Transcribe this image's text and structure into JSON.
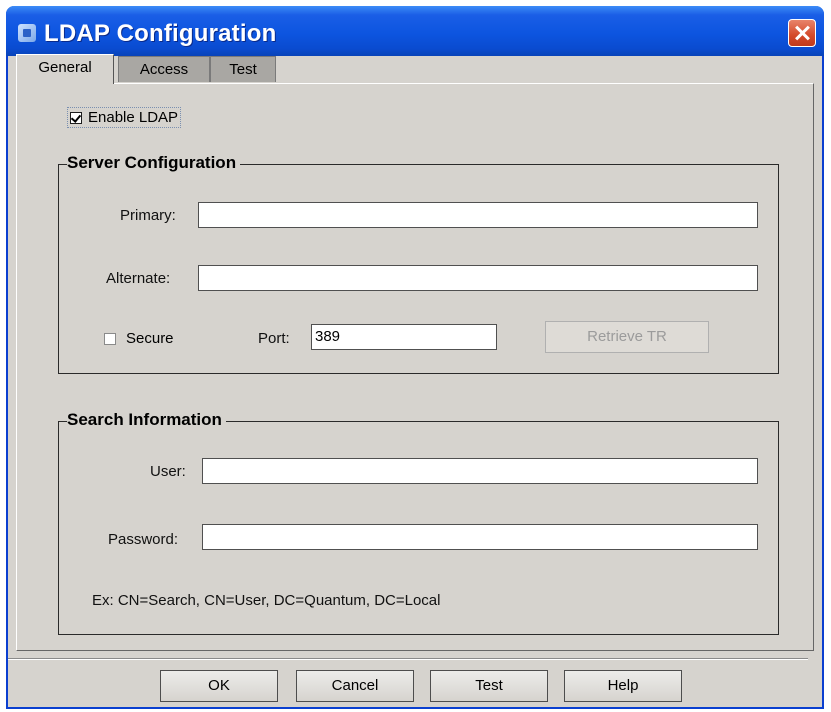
{
  "window": {
    "title": "LDAP Configuration"
  },
  "tabs": [
    {
      "label": "General",
      "active": true
    },
    {
      "label": "Access",
      "active": false
    },
    {
      "label": "Test",
      "active": false
    }
  ],
  "enable_ldap": {
    "label": "Enable LDAP",
    "checked": true
  },
  "server": {
    "title": "Server Configuration",
    "primary_label": "Primary:",
    "primary_value": "",
    "alternate_label": "Alternate:",
    "alternate_value": "",
    "secure_label": "Secure",
    "secure_checked": false,
    "port_label": "Port:",
    "port_value": "389",
    "retrieve_label": "Retrieve TR"
  },
  "search": {
    "title": "Search Information",
    "user_label": "User:",
    "user_value": "",
    "password_label": "Password:",
    "password_value": "",
    "example": "Ex: CN=Search, CN=User, DC=Quantum, DC=Local"
  },
  "buttons": {
    "ok": "OK",
    "cancel": "Cancel",
    "test": "Test",
    "help": "Help"
  },
  "colors": {
    "titlebar": "#0d55e0",
    "face": "#d6d3ce",
    "close": "#d4492a"
  }
}
